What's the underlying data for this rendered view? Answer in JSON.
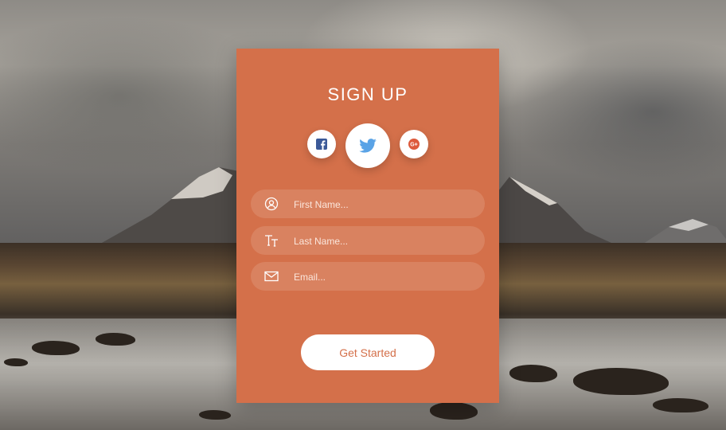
{
  "form": {
    "title": "SIGN UP",
    "social": [
      {
        "name": "facebook-icon",
        "color": "#3b5998"
      },
      {
        "name": "twitter-icon",
        "color": "#5aa3e6"
      },
      {
        "name": "google-plus-icon",
        "color": "#dd5a3c"
      }
    ],
    "fields": {
      "first_name_placeholder": "First Name...",
      "last_name_placeholder": "Last Name...",
      "email_placeholder": "Email..."
    },
    "submit_label": "Get Started"
  },
  "colors": {
    "card": "#d4704a",
    "field": "#d98260",
    "button_text": "#d4704a"
  }
}
